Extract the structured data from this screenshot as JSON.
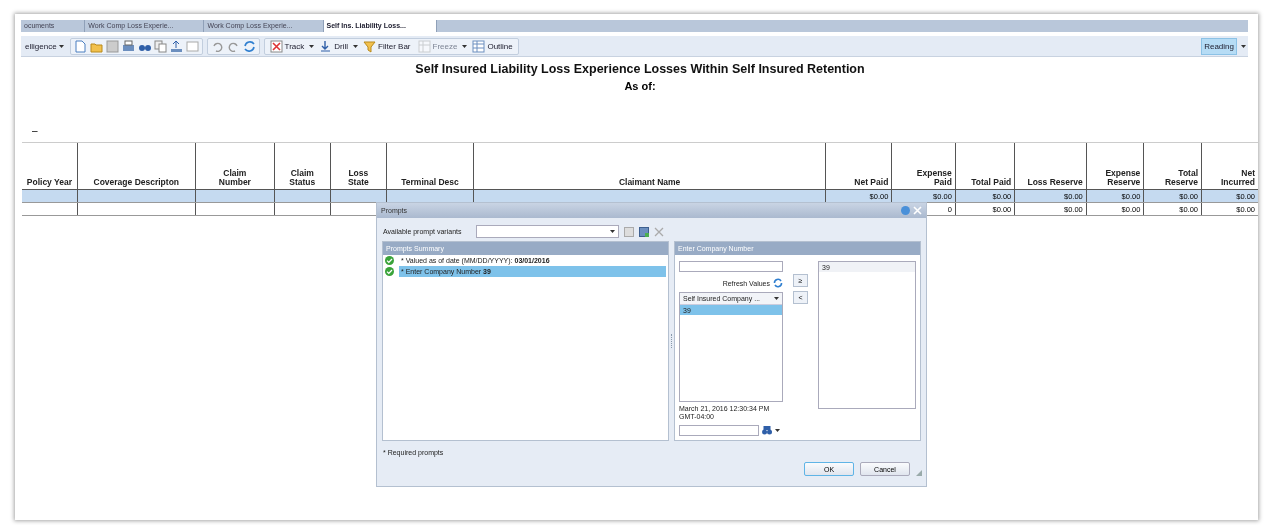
{
  "tabs": [
    {
      "label": "ocuments",
      "selected": false
    },
    {
      "label": "Work Comp Loss Experie...",
      "selected": false
    },
    {
      "label": "Work Comp Loss Experie...",
      "selected": false
    },
    {
      "label": "Self Ins. Liability Loss...",
      "selected": true
    }
  ],
  "toolbar": {
    "items": [
      {
        "kind": "menu",
        "label": "elligence"
      },
      {
        "kind": "icons"
      },
      {
        "kind": "icons"
      },
      {
        "kind": "tool",
        "label": "Track",
        "disabled": false
      },
      {
        "kind": "tool",
        "label": "Drill",
        "disabled": false
      },
      {
        "kind": "tool",
        "label": "Filter Bar",
        "disabled": false
      },
      {
        "kind": "tool",
        "label": "Freeze",
        "disabled": true
      },
      {
        "kind": "tool",
        "label": "Outline",
        "disabled": false
      }
    ],
    "mode": {
      "label": "Reading",
      "selected": true
    }
  },
  "report": {
    "title": "Self Insured Liability Loss Experience Losses Within Self Insured Retention",
    "subtitle": "As of:",
    "mark": "–",
    "table": {
      "columns": [
        {
          "label": "Policy Year"
        },
        {
          "label": "Coverage Descripton"
        },
        {
          "label": "Claim Number"
        },
        {
          "label": "Claim Status"
        },
        {
          "label": "Loss State"
        },
        {
          "label": "Terminal Desc"
        },
        {
          "label": "Claimant Name"
        },
        {
          "label": "Net Paid"
        },
        {
          "label": "Expense Paid"
        },
        {
          "label": "Total Paid"
        },
        {
          "label": "Loss Reserve"
        },
        {
          "label": "Expense Reserve"
        },
        {
          "label": "Total Reserve"
        },
        {
          "label": "Net Incurred"
        }
      ],
      "rows": [
        {
          "selected": true,
          "cells": [
            "",
            "",
            "",
            "",
            "",
            "",
            "",
            "$0.00",
            "$0.00",
            "$0.00",
            "$0.00",
            "$0.00",
            "$0.00",
            "$0.00"
          ]
        },
        {
          "selected": false,
          "cells": [
            "",
            "",
            "",
            "",
            "",
            "",
            "",
            "",
            "0",
            "$0.00",
            "$0.00",
            "$0.00",
            "$0.00",
            "$0.00"
          ]
        }
      ]
    }
  },
  "dialog": {
    "title": "Prompts",
    "variants_label": "Available prompt variants",
    "summary": {
      "header": "Prompts Summary",
      "items": [
        {
          "done": true,
          "selected": false,
          "text": "* Valued as of date (MM/DD/YYYY): **03/01/2016**"
        },
        {
          "done": true,
          "selected": true,
          "text": "* Enter Company Number **39**"
        }
      ]
    },
    "detail": {
      "header": "Enter Company Number",
      "refresh_label": "Refresh Values",
      "list_header": "Self Insured Company ...",
      "values": [
        {
          "label": "39",
          "selected": true
        }
      ],
      "timestamp": "March 21, 2016 12:30:34 PM GMT-04:00",
      "add_button": "≥",
      "remove_button": "<",
      "chosen": [
        "39"
      ]
    },
    "note": "* Required prompts",
    "buttons": [
      {
        "label": "OK",
        "focused": true
      },
      {
        "label": "Cancel",
        "focused": false
      }
    ]
  }
}
